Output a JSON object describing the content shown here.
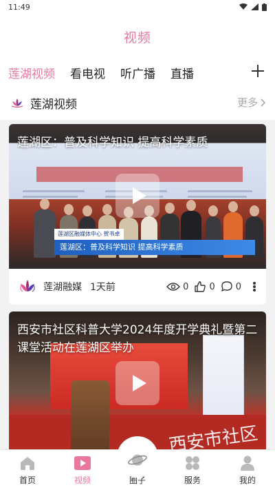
{
  "status_bar": {
    "time": "11:49"
  },
  "header": {
    "title": "视频"
  },
  "tabs": [
    {
      "label": "莲湖视频",
      "active": true
    },
    {
      "label": "看电视",
      "active": false
    },
    {
      "label": "听广播",
      "active": false
    },
    {
      "label": "直播",
      "active": false
    }
  ],
  "section": {
    "title": "莲湖视频",
    "more_label": "更多"
  },
  "cards": [
    {
      "title": "莲湖区：普及科学知识  提高科学素质",
      "image_caption": "莲湖区：普及科学知识  提高科学素质",
      "image_caption_tag": "莲湖区融媒体中心  贺书卓",
      "author": "莲湖融媒",
      "time": "1天前",
      "views": "0",
      "likes": "0",
      "comments": "0"
    },
    {
      "title": "西安市社区科普大学2024年度开学典礼暨第二课堂活动在莲湖区举办",
      "carpet_text": "西安市社区"
    }
  ],
  "bottom_nav": [
    {
      "label": "首页",
      "icon": "home-icon",
      "active": false
    },
    {
      "label": "视频",
      "icon": "video-icon",
      "active": true
    },
    {
      "label": "圈子",
      "icon": "planet-icon",
      "active": false
    },
    {
      "label": "服务",
      "icon": "services-icon",
      "active": false
    },
    {
      "label": "我的",
      "icon": "profile-icon",
      "active": false
    }
  ],
  "colors": {
    "accent": "#e8789e",
    "text": "#222222",
    "muted": "#aaaaaa",
    "background": "#f2f2f2"
  }
}
